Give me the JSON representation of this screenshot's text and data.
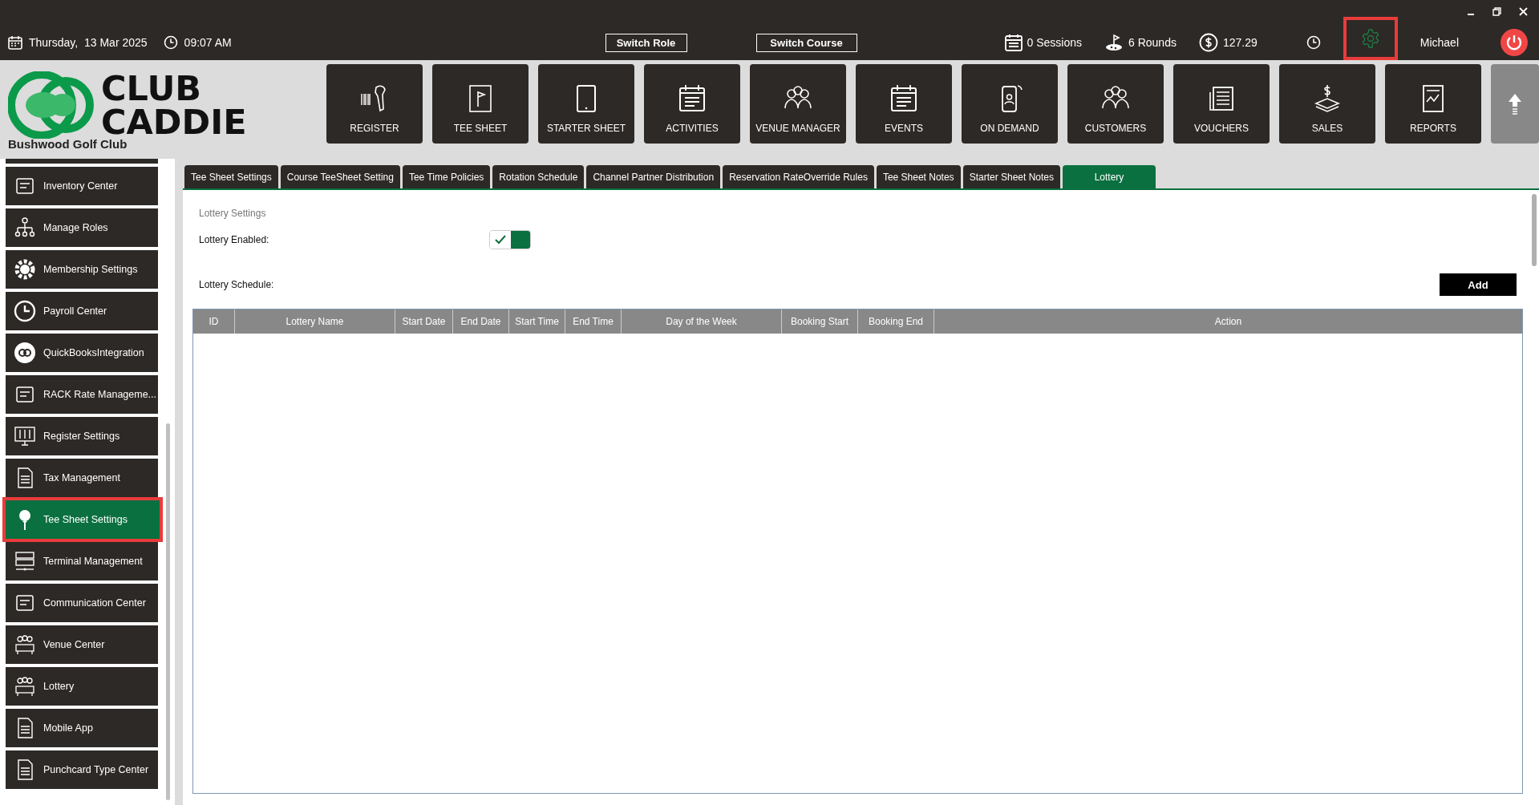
{
  "top_bar": {
    "date": "Thursday,  13 Mar 2025",
    "time": "09:07 AM",
    "buttons": [
      "Switch Role",
      "Switch Course"
    ],
    "sessions": "0 Sessions",
    "rounds": "6 Rounds",
    "balance": "127.29",
    "user": "Michael",
    "settings_highlighted": true
  },
  "logo": {
    "line1": "CLUB",
    "line2": "CADDIE",
    "club_name": "Bushwood Golf Club"
  },
  "nav": [
    {
      "label": "REGISTER"
    },
    {
      "label": "TEE SHEET"
    },
    {
      "label": "STARTER SHEET"
    },
    {
      "label": "ACTIVITIES"
    },
    {
      "label": "VENUE MANAGER"
    },
    {
      "label": "EVENTS"
    },
    {
      "label": "ON DEMAND"
    },
    {
      "label": "CUSTOMERS"
    },
    {
      "label": "VOUCHERS"
    },
    {
      "label": "SALES"
    },
    {
      "label": "REPORTS"
    }
  ],
  "sidebar": {
    "items": [
      {
        "label": "Inventory Center",
        "selected": false,
        "highlighted": false
      },
      {
        "label": "Manage Roles",
        "selected": false,
        "highlighted": false
      },
      {
        "label": "Membership Settings",
        "selected": false,
        "highlighted": false
      },
      {
        "label": "Payroll Center",
        "selected": false,
        "highlighted": false
      },
      {
        "label": "QuickBooksIntegration",
        "selected": false,
        "highlighted": false
      },
      {
        "label": "RACK Rate Manageme...",
        "selected": false,
        "highlighted": false
      },
      {
        "label": "Register Settings",
        "selected": false,
        "highlighted": false
      },
      {
        "label": "Tax Management",
        "selected": false,
        "highlighted": false
      },
      {
        "label": "Tee Sheet Settings",
        "selected": true,
        "highlighted": true
      },
      {
        "label": "Terminal Management",
        "selected": false,
        "highlighted": false
      },
      {
        "label": "Communication Center",
        "selected": false,
        "highlighted": false
      },
      {
        "label": "Venue Center",
        "selected": false,
        "highlighted": false
      },
      {
        "label": "Lottery",
        "selected": false,
        "highlighted": false
      },
      {
        "label": "Mobile App",
        "selected": false,
        "highlighted": false
      },
      {
        "label": "Punchcard Type Center",
        "selected": false,
        "highlighted": false
      }
    ]
  },
  "tabs": [
    {
      "label": "Tee Sheet Settings",
      "selected": false
    },
    {
      "label": "Course TeeSheet Setting",
      "selected": false
    },
    {
      "label": "Tee Time Policies",
      "selected": false
    },
    {
      "label": "Rotation Schedule",
      "selected": false
    },
    {
      "label": "Channel Partner Distribution",
      "selected": false
    },
    {
      "label": "Reservation RateOverride Rules",
      "selected": false
    },
    {
      "label": "Tee Sheet Notes",
      "selected": false
    },
    {
      "label": "Starter Sheet Notes",
      "selected": false
    },
    {
      "label": "Lottery",
      "selected": true
    }
  ],
  "lottery": {
    "section_title": "Lottery Settings",
    "enabled_label": "Lottery Enabled:",
    "enabled": true,
    "schedule_label": "Lottery Schedule:",
    "add_button": "Add"
  },
  "table": {
    "columns": [
      "ID",
      "Lottery Name",
      "Start Date",
      "End Date",
      "Start Time",
      "End Time",
      "Day of the Week",
      "Booking Start",
      "Booking End",
      "Action"
    ]
  }
}
